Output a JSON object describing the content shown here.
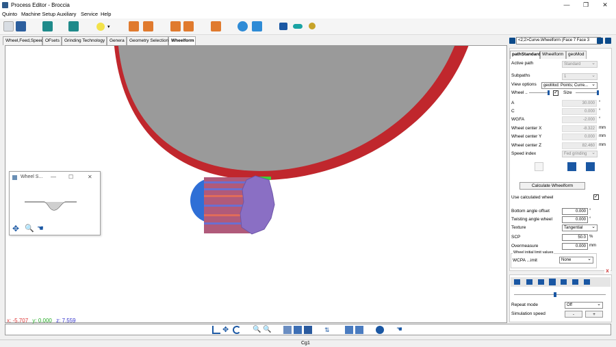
{
  "app": {
    "title": "Process Editor - Broccia"
  },
  "window_controls": {
    "minimize": "—",
    "maximize": "❐",
    "close": "✕"
  },
  "menu": [
    "Quinto",
    "Machine Setup",
    "Auxiliary",
    "Service",
    "Help"
  ],
  "tabs": [
    "Wheel,Feed,Speed",
    "OFsets",
    "Grinding Technology",
    "Genera",
    "Geometry Selection",
    "Wheelform"
  ],
  "active_tab": "Wheelform",
  "curve_selector": {
    "value": "<2;2>Curve.Wheelform (Face 7 Face 3"
  },
  "right_tabs": [
    "pathStandard",
    "Wheelform",
    "geoMod"
  ],
  "active_right_tab": "pathStandard",
  "fields": {
    "active_path": {
      "label": "Active path",
      "value": "Standard"
    },
    "subpaths": {
      "label": "Subpaths",
      "value": "1"
    },
    "view_options": {
      "label": "View options",
      "value": "geoMod: Points; Curre..."
    },
    "wheel": {
      "label": "Wheel ..",
      "size_label": "Size"
    },
    "a": {
      "label": "A",
      "value": "30.000",
      "unit": "°"
    },
    "c": {
      "label": "C",
      "value": "0.000",
      "unit": "°"
    },
    "wgfa": {
      "label": "WGFA",
      "value": "-2.000",
      "unit": "°"
    },
    "wcx": {
      "label": "Wheel center X",
      "value": "-8.322",
      "unit": "mm"
    },
    "wcy": {
      "label": "Wheel center Y",
      "value": "0.000",
      "unit": "mm"
    },
    "wcz": {
      "label": "Wheel center Z",
      "value": "82.460",
      "unit": "mm"
    },
    "speed_index": {
      "label": "Speed index",
      "value": "Fed grinding"
    }
  },
  "calculate_button": "Calculate Wheelform",
  "use_calculated": {
    "label": "Use calculated wheel",
    "checked": "✓"
  },
  "offsets": {
    "bottom_angle": {
      "label": "Bottom angle offset",
      "value": "0.000",
      "unit": "°"
    },
    "twisting_angle": {
      "label": "Twisting angle wheel",
      "value": "0.000",
      "unit": "°"
    },
    "texture": {
      "label": "Texture",
      "value": "Tangential"
    },
    "scp": {
      "label": "SCP",
      "value": "50.0",
      "unit": "%"
    },
    "overmeasure": {
      "label": "Overmeasure",
      "value": "0.000",
      "unit": "mm"
    }
  },
  "limit_group": {
    "title": "Wheel initial limit values",
    "wcpa_label": "WCPA ...imit",
    "wcpa_value": "None"
  },
  "simulation": {
    "repeat_label": "Repeat mode",
    "repeat_value": "Off",
    "speed_label": "Simulation speed",
    "minus": "-",
    "plus": "+",
    "close": "x"
  },
  "popup": {
    "title": "Wheel S...",
    "min": "—",
    "max": "☐",
    "close": "✕"
  },
  "coords": {
    "x_label": "x:",
    "x": "-5.707",
    "y_label": "y:",
    "y": "0.000",
    "z_label": "z:",
    "z": "7.559"
  },
  "status": "Cg1",
  "colors": {
    "wheel_red": "#c0272d",
    "wheel_grey": "#9a9a9a",
    "gear_purple": "#8a6fc4",
    "gear_blue": "#2f6fd6",
    "accent_blue": "#1a57a3"
  }
}
